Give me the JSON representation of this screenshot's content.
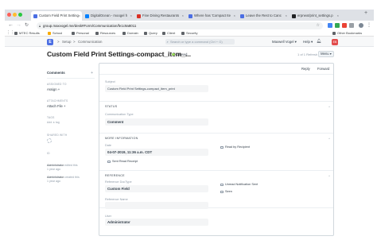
{
  "browser": {
    "tabs": [
      {
        "title": "Custom Field Print Setting",
        "active": true,
        "favicon_color": "#4b6ee3"
      },
      {
        "title": "DigitalOcean - moogel h",
        "active": false,
        "favicon_color": "#0080ff"
      },
      {
        "title": "Fine Dining Restaurants",
        "active": false,
        "favicon_color": "#d93025"
      },
      {
        "title": "Where has 'Compact Ite",
        "active": false,
        "favicon_color": "#4b6ee3"
      },
      {
        "title": "Leave the Rest to Canc",
        "active": false,
        "favicon_color": "#4b6ee3"
      },
      {
        "title": "erpnext/print_settings.p",
        "active": false,
        "favicon_color": "#202124"
      }
    ],
    "close_glyph": "×",
    "new_tab_glyph": "+",
    "url": "group.maxvogel.me/desk#Form/Communication/fe1c9a8011",
    "bookmarks": [
      {
        "label": "MTEC Results",
        "color": "#5f6368"
      },
      {
        "label": "School",
        "color": "#f9ab00"
      },
      {
        "label": "Personal",
        "color": "#5f6368"
      },
      {
        "label": "Resources",
        "color": "#5f6368"
      },
      {
        "label": "Domain",
        "color": "#5f6368"
      },
      {
        "label": "Query",
        "color": "#5f6368"
      },
      {
        "label": "Client",
        "color": "#5f6368"
      },
      {
        "label": "Security",
        "color": "#5f6368"
      }
    ],
    "other_bookmarks": "Other Bookmarks"
  },
  "app": {
    "logo_letter": "E",
    "breadcrumbs": [
      "Setup",
      "Communication"
    ],
    "breadcrumb_separator": ">",
    "search_placeholder": "Search or type a command (Ctrl + G)",
    "user_menu": "Maxwell Vogel",
    "help_menu": "Help",
    "avatar_initials": "EB"
  },
  "page": {
    "title": "Custom Field Print Settings-compact_item_...",
    "status": "Closed",
    "pager": "1 of 1 Refresh",
    "menu_label": "Menu"
  },
  "sidebar": {
    "comments_heading": "Comments",
    "add_glyph": "+",
    "assigned_to_label": "ASSIGNED TO",
    "assign_text": "Assign",
    "attachments_label": "ATTACHMENTS",
    "attach_text": "Attach File",
    "tags_label": "TAGS",
    "add_tag_text": "Add a tag",
    "shared_label": "SHARED WITH",
    "id_label": "ID",
    "timeline": [
      {
        "user": "Administrator",
        "action": "edited this",
        "when": "1 year ago"
      },
      {
        "user": "Administrator",
        "action": "created this",
        "when": "1 year ago"
      }
    ]
  },
  "form": {
    "actions": [
      "Reply",
      "Reply All",
      "Forward"
    ],
    "subject_label": "Subject",
    "subject_value": "Custom Field Print Settings-compact_item_print",
    "status_section": "STATUS",
    "comm_type_label": "Communication Type",
    "comm_type_value": "Comment",
    "more_info_section": "MORE INFORMATION",
    "date_label": "Date",
    "date_value": "04-07-2019, 11:36 a.m. CDT",
    "read_by_recipient": "Read by Recipient",
    "sent_read_receipt": "Sent Read Receipt",
    "reference_section": "REFERENCE",
    "ref_doctype_label": "Reference DocType",
    "ref_doctype_value": "Custom Field",
    "ref_name_label": "Reference Name",
    "unread_notification": "Unread Notification Sent",
    "seen_label": "Seen",
    "user_label": "User",
    "user_value": "Administrator",
    "collapse_glyph": "^"
  }
}
